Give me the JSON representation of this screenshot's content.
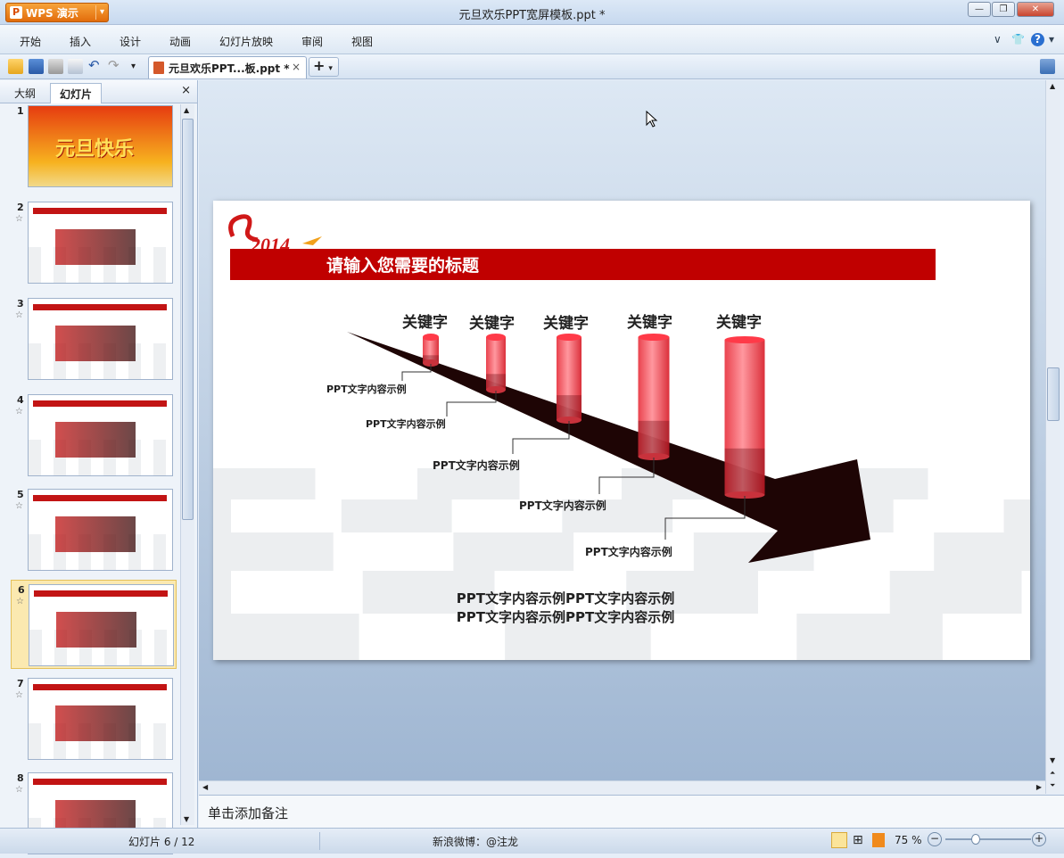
{
  "app": {
    "button_label": "WPS 演示",
    "window_title": "元旦欢乐PPT宽屏模板.ppt *"
  },
  "menu": {
    "items": [
      "开始",
      "插入",
      "设计",
      "动画",
      "幻灯片放映",
      "审阅",
      "视图"
    ]
  },
  "doc_tab": {
    "label": "元旦欢乐PPT...板.ppt *",
    "close": "×"
  },
  "sidebar": {
    "tabs": [
      "大纲",
      "幻灯片"
    ],
    "active_tab": "幻灯片",
    "close": "×",
    "thumbnails": [
      {
        "num": "1",
        "theme": "title",
        "selected": false,
        "title_text": "元旦快乐"
      },
      {
        "num": "2",
        "theme": "content",
        "selected": false
      },
      {
        "num": "3",
        "theme": "content",
        "selected": false
      },
      {
        "num": "4",
        "theme": "content",
        "selected": false
      },
      {
        "num": "5",
        "theme": "content",
        "selected": false
      },
      {
        "num": "6",
        "theme": "content",
        "selected": true
      },
      {
        "num": "7",
        "theme": "content",
        "selected": false
      },
      {
        "num": "8",
        "theme": "content",
        "selected": false
      }
    ]
  },
  "slide": {
    "year_logo": "2014",
    "title": "请输入您需要的标题",
    "keywords": [
      "关键字",
      "关键字",
      "关键字",
      "关键字",
      "关键字"
    ],
    "captions": [
      "PPT文字内容示例",
      "PPT文字内容示例",
      "PPT文字内容示例",
      "PPT文字内容示例",
      "PPT文字内容示例"
    ],
    "body_lines": [
      "PPT文字内容示例PPT文字内容示例",
      "PPT文字内容示例PPT文字内容示例"
    ],
    "colors": {
      "title_bar": "#c00000",
      "arrow": "#1e0505",
      "cylinder": "#ff4a55"
    }
  },
  "notes": {
    "placeholder": "单击添加备注"
  },
  "status": {
    "slide_counter": "幻灯片 6 / 12",
    "weibo": "新浪微博：@注龙",
    "zoom": "75 %"
  }
}
